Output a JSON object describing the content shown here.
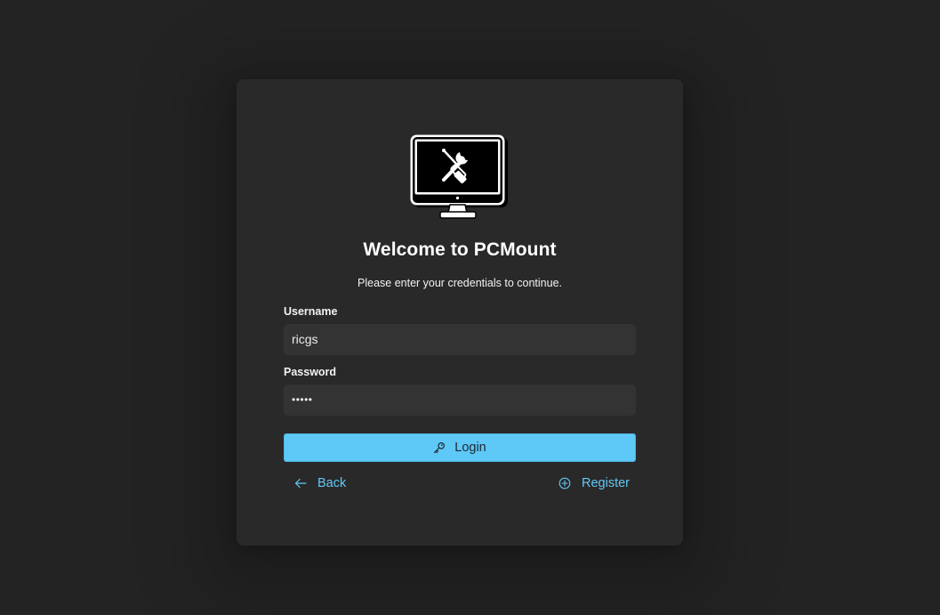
{
  "window": {
    "app_name": "PCMount"
  },
  "logo": {
    "icon": "monitor-with-tools-icon"
  },
  "header": {
    "title": "Welcome to PCMount",
    "subtitle": "Please enter your credentials to continue."
  },
  "form": {
    "username_label": "Username",
    "username_value": "ricgs",
    "password_label": "Password",
    "password_value": "•••••"
  },
  "actions": {
    "login_label": "Login",
    "login_icon": "key-icon",
    "back_label": "Back",
    "back_icon": "arrow-left-icon",
    "register_label": "Register",
    "register_icon": "plus-circle-icon"
  },
  "colors": {
    "background": "#232323",
    "card": "#292929",
    "input": "#333333",
    "accent": "#5ec8f7",
    "link": "#62c8f5"
  }
}
